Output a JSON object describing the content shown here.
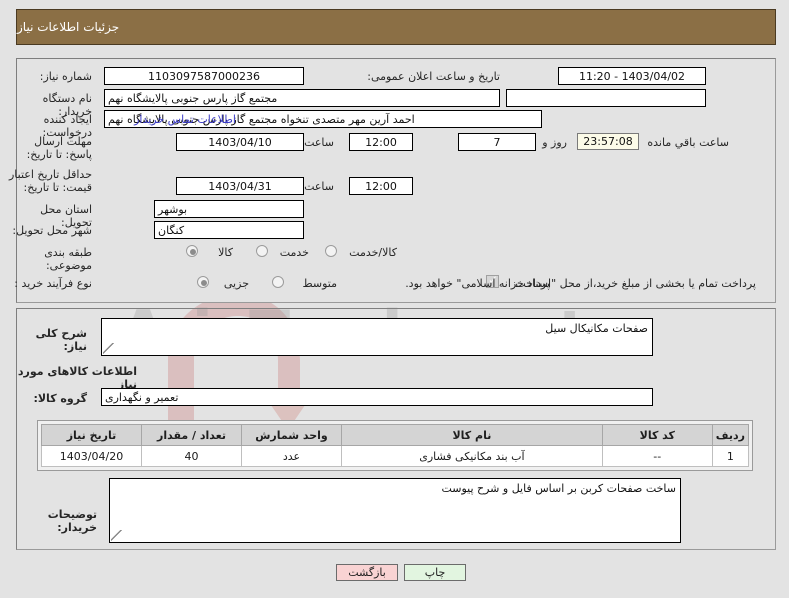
{
  "header": {
    "title": "جزئیات اطلاعات نیاز"
  },
  "form": {
    "need_number": {
      "label": "شماره نیاز:",
      "value": "1103097587000236"
    },
    "announce_datetime": {
      "label": "تاریخ و ساعت اعلان عمومی:",
      "value": "1403/04/02 - 11:20"
    },
    "buyer_org": {
      "label": "نام دستگاه خریدار:",
      "value": "مجتمع گاز پارس جنوبی  پالایشگاه نهم",
      "secondary_value": ""
    },
    "request_creator": {
      "label": "ایجاد کننده درخواست:",
      "value": "احمد آرین مهر متصدی تنخواه مجتمع گاز پارس جنوبی  پالایشگاه نهم"
    },
    "buyer_contact_link": "اطلاعات تماس خریدار",
    "response_deadline": {
      "label": "مهلت ارسال پاسخ: تا تاریخ:",
      "date": "1403/04/10",
      "time_label": "ساعت",
      "time": "12:00",
      "days_value": "7",
      "days_label": "روز و",
      "countdown": "23:57:08",
      "remaining_label": "ساعت باقي مانده"
    },
    "price_validity": {
      "label": "حداقل تاریخ اعتبار قیمت: تا تاریخ:",
      "date": "1403/04/31",
      "time_label": "ساعت",
      "time": "12:00"
    },
    "delivery_province": {
      "label": "استان محل تحویل:",
      "value": "بوشهر"
    },
    "delivery_city": {
      "label": "شهر محل تحویل:",
      "value": "کنگان"
    },
    "subject_category": {
      "label": "طبقه بندی موضوعی:",
      "options": [
        "کالا",
        "خدمت",
        "کالا/خدمت"
      ],
      "selected": "کالا"
    },
    "purchase_process": {
      "label": "نوع فرآیند خرید :",
      "options": [
        "جزیی",
        "متوسط"
      ],
      "selected": "جزیی"
    },
    "treasury_note": {
      "checked": true,
      "label": "پرداخت",
      "text": "پرداخت تمام یا بخشی از مبلغ خرید،از محل \"اسناد خزانه اسلامی\" خواهد بود."
    }
  },
  "middle": {
    "need_summary": {
      "label": "شرح کلی نیاز:",
      "value": "صفحات مکانیکال سیل"
    },
    "goods_section_title": "اطلاعات کالاهای مورد نیاز",
    "goods_group": {
      "label": "گروه کالا:",
      "value": "تعمیر و نگهداری"
    }
  },
  "table": {
    "headers": [
      "ردیف",
      "کد کالا",
      "نام کالا",
      "واحد شمارش",
      "تعداد / مقدار",
      "تاریخ نیاز"
    ],
    "rows": [
      {
        "row": "1",
        "code": "--",
        "name": "آب بند مکانیکی فشاری",
        "unit": "عدد",
        "quantity": "40",
        "need_date": "1403/04/20"
      }
    ]
  },
  "buyer_notes": {
    "label": "توضیحات خریدار:",
    "value": "ساخت صفحات کربن بر اساس فایل و شرح پیوست"
  },
  "buttons": {
    "back": "بازگشت",
    "print": "چاپ"
  },
  "watermark": {
    "text": "AriaTender.net"
  },
  "colors": {
    "header_bg": "#8b6f45",
    "page_bg": "#e3e3e3",
    "link": "#3c3cc8",
    "back_btn": "#f9d3d3",
    "print_btn": "#e2f5e0",
    "timer_bg": "#fcfbe8"
  }
}
